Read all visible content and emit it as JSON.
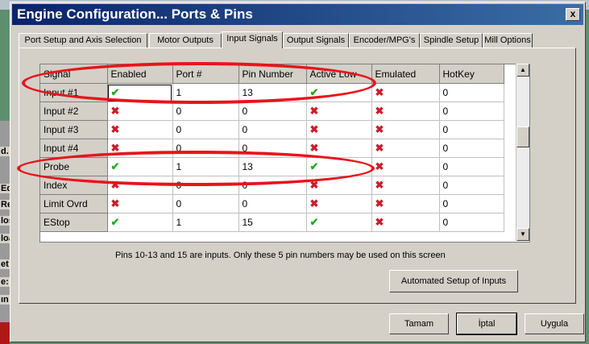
{
  "dialog": {
    "title": "Engine Configuration... Ports & Pins",
    "close_label": "x"
  },
  "tabs": [
    {
      "label": "Port Setup and Axis Selection",
      "active": false
    },
    {
      "label": "Motor Outputs",
      "active": false
    },
    {
      "label": "Input Signals",
      "active": true
    },
    {
      "label": "Output Signals",
      "active": false
    },
    {
      "label": "Encoder/MPG's",
      "active": false
    },
    {
      "label": "Spindle Setup",
      "active": false
    },
    {
      "label": "Mill Options",
      "active": false
    }
  ],
  "table": {
    "columns": [
      "Signal",
      "Enabled",
      "Port #",
      "Pin Number",
      "Active Low",
      "Emulated",
      "HotKey"
    ],
    "rows": [
      {
        "signal": "Input #1",
        "enabled": "check",
        "port": "1",
        "pin": "13",
        "active_low": "check",
        "emulated": "cross",
        "hotkey": "0"
      },
      {
        "signal": "Input #2",
        "enabled": "cross",
        "port": "0",
        "pin": "0",
        "active_low": "cross",
        "emulated": "cross",
        "hotkey": "0"
      },
      {
        "signal": "Input #3",
        "enabled": "cross",
        "port": "0",
        "pin": "0",
        "active_low": "cross",
        "emulated": "cross",
        "hotkey": "0"
      },
      {
        "signal": "Input #4",
        "enabled": "cross",
        "port": "0",
        "pin": "0",
        "active_low": "cross",
        "emulated": "cross",
        "hotkey": "0"
      },
      {
        "signal": "Probe",
        "enabled": "check",
        "port": "1",
        "pin": "13",
        "active_low": "check",
        "emulated": "cross",
        "hotkey": "0"
      },
      {
        "signal": "Index",
        "enabled": "cross",
        "port": "0",
        "pin": "0",
        "active_low": "cross",
        "emulated": "cross",
        "hotkey": "0"
      },
      {
        "signal": "Limit Ovrd",
        "enabled": "cross",
        "port": "0",
        "pin": "0",
        "active_low": "cross",
        "emulated": "cross",
        "hotkey": "0"
      },
      {
        "signal": "EStop",
        "enabled": "check",
        "port": "1",
        "pin": "15",
        "active_low": "check",
        "emulated": "cross",
        "hotkey": "0"
      }
    ]
  },
  "note": "Pins 10-13 and 15 are inputs. Only these 5 pin numbers may be used on this screen",
  "buttons": {
    "auto_setup": "Automated Setup of Inputs",
    "ok": "Tamam",
    "cancel": "İptal",
    "apply": "Uygula"
  },
  "background_fragments": [
    "d.",
    "Edi",
    "Re",
    "los",
    "loa",
    "et",
    "e:",
    "ın"
  ],
  "icons": {
    "check": "✔",
    "cross": "✖"
  },
  "colors": {
    "check": "#22aa22",
    "cross": "#c81e2c",
    "annotation": "#e8141c",
    "titlebar": "#0a246a"
  }
}
